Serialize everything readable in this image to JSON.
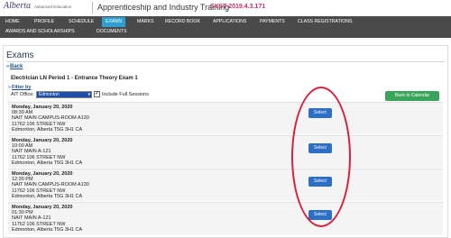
{
  "header": {
    "logo_text": "Alberta",
    "logo_sub": "Advanced Education",
    "app_title": "Apprenticeship and Industry Training",
    "system_version": "SYST 2019.4.3.171"
  },
  "nav": {
    "items": [
      "HOME",
      "PROFILE",
      "SCHEDULE",
      "EXAMS",
      "MARKS",
      "RECORD BOOK",
      "APPLICATIONS",
      "PAYMENTS",
      "CLASS REGISTRATIONS",
      "AWARDS AND SCHOLARSHIPS",
      "DOCUMENTS"
    ],
    "active": "EXAMS"
  },
  "page": {
    "title": "Exams",
    "back_label": "Back",
    "exam_heading": "Electrician LN Period 1 - Entrance Theory Exam 1",
    "filter_label": "Filter by",
    "office_label": "AIT Office:",
    "office_value": "Edmonton",
    "include_full_label": "Include Full Sessions",
    "include_full_checked": true,
    "calendar_button": "Back to Calendar"
  },
  "sessions": [
    {
      "date": "Monday, January 20, 2020",
      "time": "08:30 AM",
      "location": "NAIT MAIN CAMPUS-ROOM A130",
      "street": "11762 106 STREET NW",
      "city": "Edmonton, Alberta T5G 3H1 CA",
      "action": "Select"
    },
    {
      "date": "Monday, January 20, 2020",
      "time": "10:00 AM",
      "location": "NAIT MAIN A-121",
      "street": "11762 106 STREET NW",
      "city": "Edmonton, Alberta T5G 3H1 CA",
      "action": "Select"
    },
    {
      "date": "Monday, January 20, 2020",
      "time": "12:30 PM",
      "location": "NAIT MAIN CAMPUS-ROOM A130",
      "street": "11762 106 STREET NW",
      "city": "Edmonton, Alberta T5G 3H1 CA",
      "action": "Select"
    },
    {
      "date": "Monday, January 20, 2020",
      "time": "01:30 PM",
      "location": "NAIT MAIN A-121",
      "street": "11762 106 STREET NW",
      "city": "Edmonton, Alberta T5G 3H1 CA",
      "action": "Select"
    }
  ],
  "colors": {
    "nav_bg": "#4a4a4a",
    "nav_active": "#2ea0d0",
    "select_button": "#2d6fc4",
    "calendar_button": "#3aa55a",
    "highlight": "#d8203a"
  }
}
